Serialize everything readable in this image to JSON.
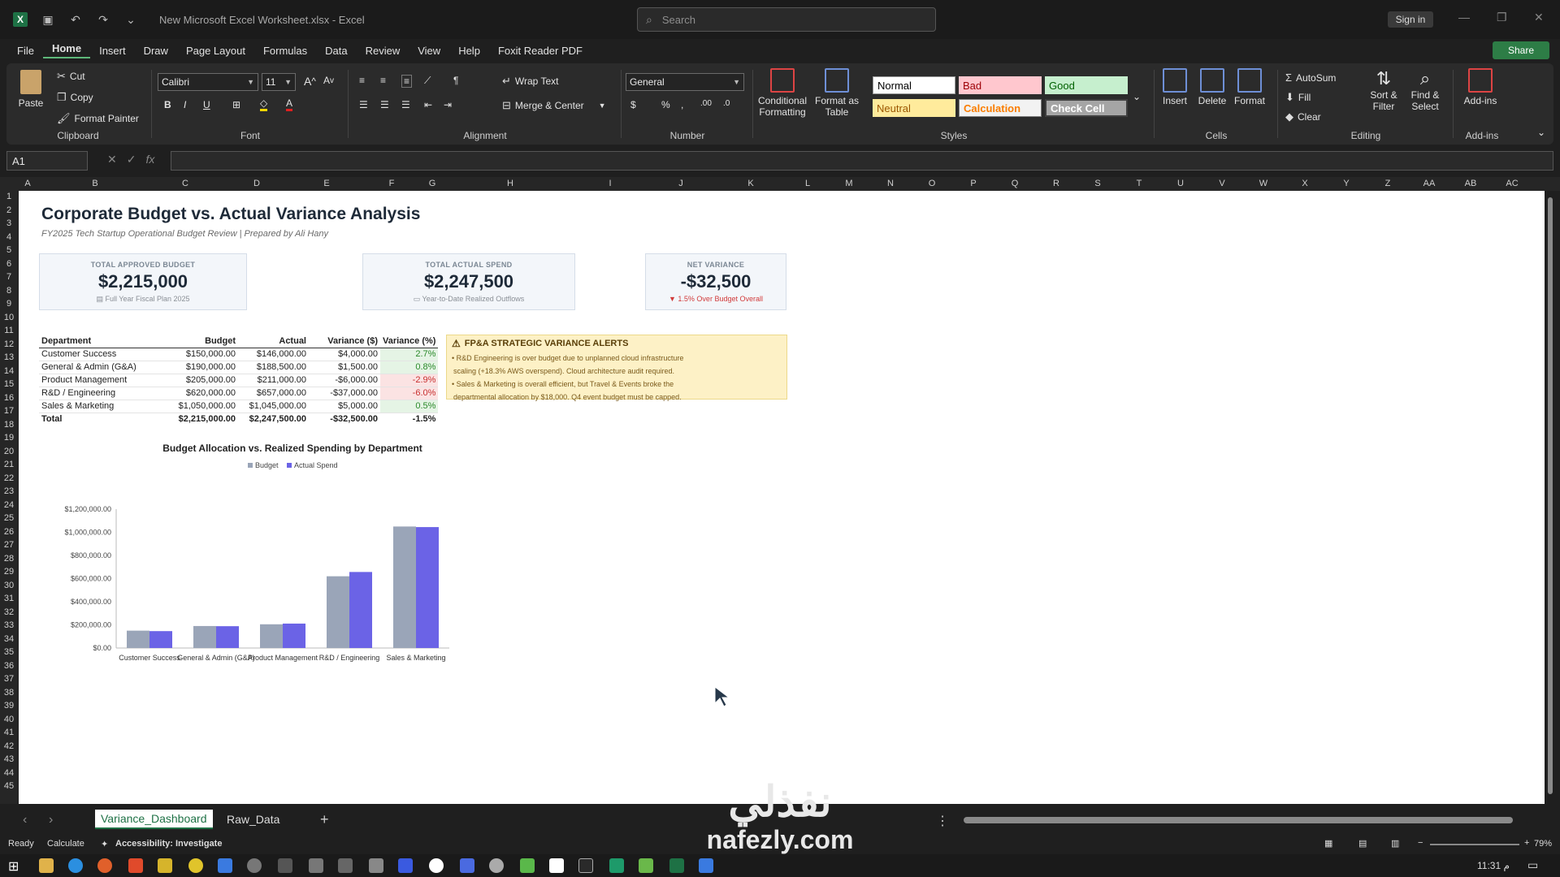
{
  "window": {
    "title": "New Microsoft Excel Worksheet.xlsx  -  Excel",
    "search_placeholder": "Search",
    "sign_in": "Sign in"
  },
  "menu": [
    "File",
    "Home",
    "Insert",
    "Draw",
    "Page Layout",
    "Formulas",
    "Data",
    "Review",
    "View",
    "Help",
    "Foxit Reader PDF"
  ],
  "share_label": "Share",
  "ribbon": {
    "clipboard": {
      "paste": "Paste",
      "cut": "Cut",
      "copy": "Copy",
      "format_painter": "Format Painter",
      "label": "Clipboard"
    },
    "font": {
      "family": "Calibri",
      "size": "11",
      "label": "Font"
    },
    "alignment": {
      "wrap_text": "Wrap Text",
      "merge_center": "Merge & Center",
      "label": "Alignment"
    },
    "number": {
      "format": "General",
      "label": "Number"
    },
    "styles": {
      "conditional_formatting": "Conditional Formatting",
      "format_as_table": "Format as Table",
      "normal": "Normal",
      "bad": "Bad",
      "good": "Good",
      "neutral": "Neutral",
      "calculation": "Calculation",
      "check_cell": "Check Cell",
      "label": "Styles"
    },
    "cells": {
      "insert": "Insert",
      "delete": "Delete",
      "format": "Format",
      "label": "Cells"
    },
    "editing": {
      "autosum": "AutoSum",
      "fill": "Fill",
      "clear": "Clear",
      "sort_filter": "Sort & Filter",
      "find_select": "Find & Select",
      "label": "Editing"
    },
    "addins": {
      "addins": "Add-ins",
      "label": "Add-ins"
    }
  },
  "formula_bar": {
    "name_box": "A1",
    "fx": "fx",
    "content": ""
  },
  "columns": [
    "A",
    "B",
    "C",
    "D",
    "E",
    "F",
    "G",
    "H",
    "I",
    "J",
    "K",
    "L",
    "M",
    "N",
    "O",
    "P",
    "Q",
    "R",
    "S",
    "T",
    "U",
    "V",
    "W",
    "X",
    "Y",
    "Z",
    "AA",
    "AB",
    "AC"
  ],
  "rows": [
    "1",
    "2",
    "3",
    "4",
    "5",
    "6",
    "7",
    "8",
    "9",
    "10",
    "11",
    "12",
    "13",
    "14",
    "15",
    "16",
    "17",
    "18",
    "19",
    "20",
    "21",
    "22",
    "23",
    "24",
    "25",
    "26",
    "27",
    "28",
    "29",
    "30",
    "31",
    "32",
    "33",
    "34",
    "35",
    "36",
    "37",
    "38",
    "39",
    "40",
    "41",
    "42",
    "43",
    "44",
    "45"
  ],
  "dashboard": {
    "title": "Corporate Budget vs. Actual Variance Analysis",
    "subtitle": "FY2025 Tech Startup Operational Budget Review | Prepared by Ali Hany",
    "kpis": [
      {
        "label": "TOTAL APPROVED BUDGET",
        "value": "$2,215,000",
        "note": "Full Year Fiscal Plan 2025"
      },
      {
        "label": "TOTAL ACTUAL SPEND",
        "value": "$2,247,500",
        "note": "Year-to-Date Realized Outflows"
      },
      {
        "label": "NET VARIANCE",
        "value": "-$32,500",
        "note": "1.5% Over Budget Overall"
      }
    ],
    "table": {
      "headers": [
        "Department",
        "Budget",
        "Actual",
        "Variance ($)",
        "Variance (%)"
      ],
      "rows": [
        [
          "Customer Success",
          "$150,000.00",
          "$146,000.00",
          "$4,000.00",
          "2.7%"
        ],
        [
          "General & Admin (G&A)",
          "$190,000.00",
          "$188,500.00",
          "$1,500.00",
          "0.8%"
        ],
        [
          "Product Management",
          "$205,000.00",
          "$211,000.00",
          "-$6,000.00",
          "-2.9%"
        ],
        [
          "R&D / Engineering",
          "$620,000.00",
          "$657,000.00",
          "-$37,000.00",
          "-6.0%"
        ],
        [
          "Sales & Marketing",
          "$1,050,000.00",
          "$1,045,000.00",
          "$5,000.00",
          "0.5%"
        ]
      ],
      "total": [
        "Total",
        "$2,215,000.00",
        "$2,247,500.00",
        "-$32,500.00",
        "-1.5%"
      ]
    },
    "alert": {
      "heading": "FP&A STRATEGIC VARIANCE ALERTS",
      "lines": [
        "• R&D Engineering is over budget due to unplanned cloud infrastructure",
        "  scaling (+18.3% AWS overspend). Cloud architecture audit required.",
        "• Sales & Marketing is overall efficient, but Travel & Events broke the",
        "  departmental allocation by $18,000. Q4 event budget must be capped."
      ]
    }
  },
  "chart_data": {
    "type": "bar",
    "title": "Budget Allocation vs. Realized Spending by Department",
    "categories": [
      "Customer Success",
      "General & Admin (G&A)",
      "Product Management",
      "R&D / Engineering",
      "Sales & Marketing"
    ],
    "series": [
      {
        "name": "Budget",
        "values": [
          150000,
          190000,
          205000,
          620000,
          1050000
        ],
        "color": "#9aa5b8"
      },
      {
        "name": "Actual Spend",
        "values": [
          146000,
          188500,
          211000,
          657000,
          1045000
        ],
        "color": "#6b63e6"
      }
    ],
    "ylim": [
      0,
      1200000
    ],
    "yticks": [
      "$0.00",
      "$200,000.00",
      "$400,000.00",
      "$600,000.00",
      "$800,000.00",
      "$1,000,000.00",
      "$1,200,000.00"
    ],
    "legend": "top"
  },
  "sheets": [
    "Variance_Dashboard",
    "Raw_Data"
  ],
  "status": {
    "ready": "Ready",
    "calculate": "Calculate",
    "accessibility": "Accessibility: Investigate",
    "zoom": "79%"
  },
  "taskbar": {
    "time": "11:31 م"
  },
  "watermark": {
    "arabic": "نفذلي",
    "latin": "nafezly.com"
  }
}
